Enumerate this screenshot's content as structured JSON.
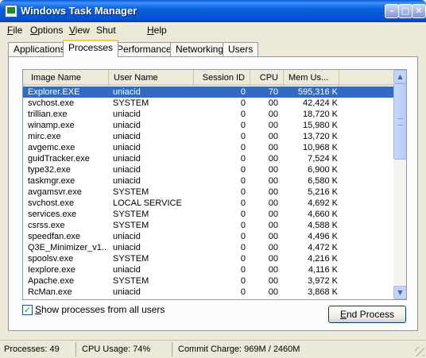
{
  "window": {
    "title": "Windows Task Manager",
    "controls": {
      "minimize": "–",
      "maximize": "□",
      "close": "✕"
    }
  },
  "menu": [
    {
      "acc": "F",
      "rest": "ile"
    },
    {
      "acc": "O",
      "rest": "ptions"
    },
    {
      "acc": "V",
      "rest": "iew"
    },
    {
      "pre": "Shut ",
      "acc": "D",
      "rest": "own"
    },
    {
      "acc": "H",
      "rest": "elp"
    }
  ],
  "tabs": [
    "Applications",
    "Processes",
    "Performance",
    "Networking",
    "Users"
  ],
  "active_tab": "Processes",
  "table": {
    "columns": [
      "Image Name",
      "User Name",
      "Session ID",
      "CPU",
      "Mem Us..."
    ],
    "selected_index": 0,
    "rows": [
      [
        "Explorer.EXE",
        "uniacid",
        "0",
        "70",
        "595,316 K"
      ],
      [
        "svchost.exe",
        "SYSTEM",
        "0",
        "00",
        "42,424 K"
      ],
      [
        "trillian.exe",
        "uniacid",
        "0",
        "00",
        "18,720 K"
      ],
      [
        "winamp.exe",
        "uniacid",
        "0",
        "00",
        "15,980 K"
      ],
      [
        "mirc.exe",
        "uniacid",
        "0",
        "00",
        "13,720 K"
      ],
      [
        "avgemc.exe",
        "uniacid",
        "0",
        "00",
        "10,968 K"
      ],
      [
        "guidTracker.exe",
        "uniacid",
        "0",
        "00",
        "7,524 K"
      ],
      [
        "type32.exe",
        "uniacid",
        "0",
        "00",
        "6,900 K"
      ],
      [
        "taskmgr.exe",
        "uniacid",
        "0",
        "00",
        "6,580 K"
      ],
      [
        "avgamsvr.exe",
        "SYSTEM",
        "0",
        "00",
        "5,216 K"
      ],
      [
        "svchost.exe",
        "LOCAL SERVICE",
        "0",
        "00",
        "4,692 K"
      ],
      [
        "services.exe",
        "SYSTEM",
        "0",
        "00",
        "4,660 K"
      ],
      [
        "csrss.exe",
        "SYSTEM",
        "0",
        "00",
        "4,588 K"
      ],
      [
        "speedfan.exe",
        "uniacid",
        "0",
        "00",
        "4,496 K"
      ],
      [
        "Q3E_Minimizer_v1...",
        "uniacid",
        "0",
        "00",
        "4,472 K"
      ],
      [
        "spoolsv.exe",
        "SYSTEM",
        "0",
        "00",
        "4,216 K"
      ],
      [
        "Iexplore.exe",
        "uniacid",
        "0",
        "00",
        "4,116 K"
      ],
      [
        "Apache.exe",
        "SYSTEM",
        "0",
        "00",
        "3,972 K"
      ],
      [
        "RcMan.exe",
        "uniacid",
        "0",
        "00",
        "3,868 K"
      ]
    ]
  },
  "show_all_users": {
    "checked": true,
    "mark": "✓",
    "acc": "S",
    "rest": "how processes from all users"
  },
  "end_process": {
    "acc": "E",
    "rest": "nd Process"
  },
  "status": {
    "processes": "Processes: 49",
    "cpu": "CPU Usage: 74%",
    "commit": "Commit Charge: 969M / 2460M"
  }
}
